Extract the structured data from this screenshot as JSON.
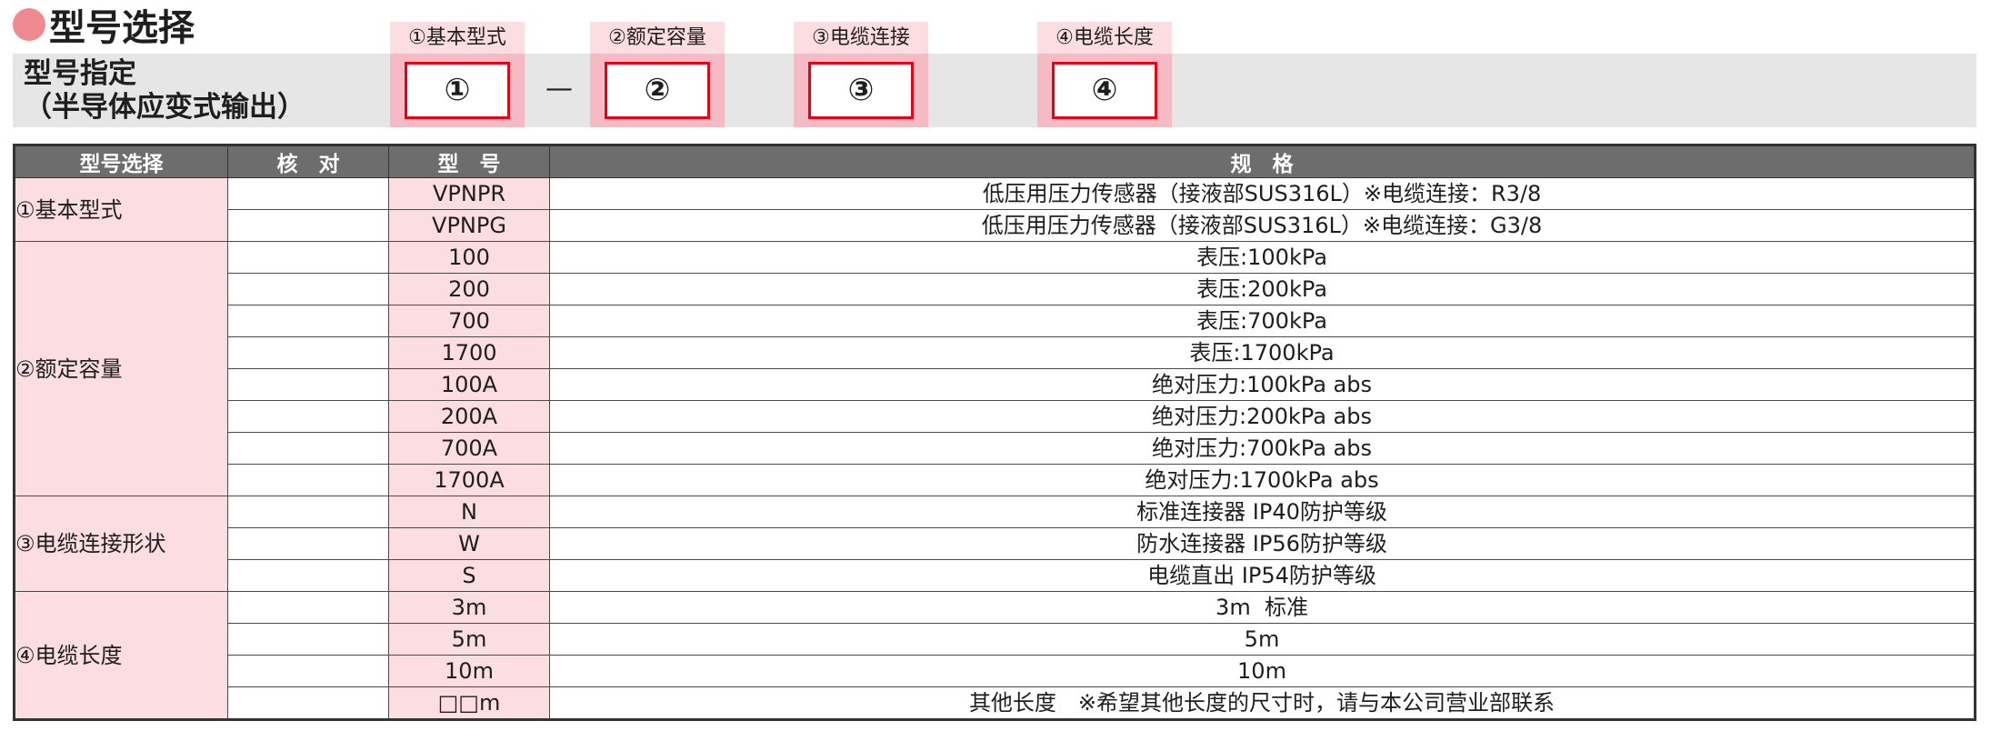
{
  "page": {
    "title": "型号选择"
  },
  "spec_band": {
    "line1": "型号指定",
    "line2": "（半导体应变式输出）"
  },
  "code_parts": [
    {
      "header": "①基本型式",
      "symbol": "①"
    },
    {
      "header": "②额定容量",
      "symbol": "②"
    },
    {
      "header": "③电缆连接",
      "symbol": "③"
    },
    {
      "header": "④电缆长度",
      "symbol": "④"
    }
  ],
  "separator": "—",
  "table": {
    "headers": [
      "型号选择",
      "核　对",
      "型　号",
      "规　格"
    ],
    "groups": [
      {
        "label": "①基本型式",
        "rows": [
          {
            "code": "VPNPR",
            "spec": "低压用压力传感器（接液部SUS316L）※电缆连接：R3/8"
          },
          {
            "code": "VPNPG",
            "spec": "低压用压力传感器（接液部SUS316L）※电缆连接：G3/8"
          }
        ]
      },
      {
        "label": "②额定容量",
        "rows": [
          {
            "code": "100",
            "spec": "表压:100kPa"
          },
          {
            "code": "200",
            "spec": "表压:200kPa"
          },
          {
            "code": "700",
            "spec": "表压:700kPa"
          },
          {
            "code": "1700",
            "spec": "表压:1700kPa"
          },
          {
            "code": "100A",
            "spec": "绝对压力:100kPa abs"
          },
          {
            "code": "200A",
            "spec": "绝对压力:200kPa abs"
          },
          {
            "code": "700A",
            "spec": "绝对压力:700kPa abs"
          },
          {
            "code": "1700A",
            "spec": "绝对压力:1700kPa abs"
          }
        ]
      },
      {
        "label": "③电缆连接形状",
        "rows": [
          {
            "code": "N",
            "spec": "标准连接器 IP40防护等级"
          },
          {
            "code": "W",
            "spec": "防水连接器 IP56防护等级"
          },
          {
            "code": "S",
            "spec": "电缆直出 IP54防护等级"
          }
        ]
      },
      {
        "label": "④电缆长度",
        "rows": [
          {
            "code": "3m",
            "spec": "3m  标准"
          },
          {
            "code": "5m",
            "spec": "5m"
          },
          {
            "code": "10m",
            "spec": "10m"
          },
          {
            "code": "□□m",
            "spec": "其他长度　※希望其他长度的尺寸时，请与本公司营业部联系"
          }
        ]
      }
    ]
  },
  "colors": {
    "title_dot": "#ee8a90",
    "header_pink": "#fcdde2",
    "box_pink": "#f5bac3",
    "slot_border_red": "#e60012",
    "band_gray": "#e6e6e6",
    "table_header_gray": "#6d6d6d"
  }
}
